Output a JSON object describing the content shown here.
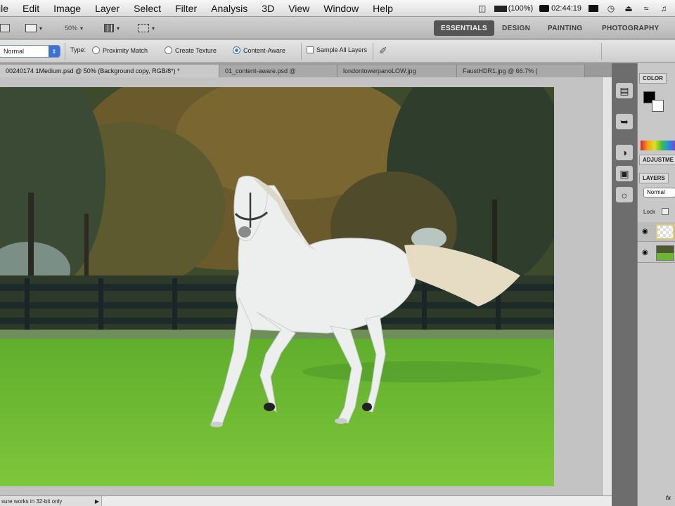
{
  "menubar": {
    "items": [
      "ile",
      "Edit",
      "Image",
      "Layer",
      "Select",
      "Filter",
      "Analysis",
      "3D",
      "View",
      "Window",
      "Help"
    ],
    "battery": "(100%)",
    "clock": "02:44:19"
  },
  "appbar": {
    "zoom": "50%",
    "workspaces": [
      "ESSENTIALS",
      "DESIGN",
      "PAINTING",
      "PHOTOGRAPHY"
    ],
    "active_workspace": "ESSENTIALS"
  },
  "options": {
    "mode": "Normal",
    "type_label": "Type:",
    "proximity": "Proximity Match",
    "create_texture": "Create Texture",
    "content_aware": "Content-Aware",
    "sample_all": "Sample All Layers",
    "selected_type": "Content-Aware"
  },
  "doc_tabs": [
    "00240174 1Medium.psd @ 50% (Background copy, RGB/8*) *",
    "01_content-aware.psd @",
    "londontowerpanoLOW.jpg",
    "FaustHDR1.jpg @ 66.7% ("
  ],
  "status": {
    "text": "sure works in 32-bit only"
  },
  "panels": {
    "color_tab": "COLOR",
    "adjustments_tab": "ADJUSTME",
    "layers_tab": "LAYERS",
    "blend_mode": "Normal",
    "lock_label": "Lock",
    "bottom_label": "fx"
  },
  "colors": {
    "accent": "#3b72d6",
    "workspace_active_bg": "#555555",
    "foreground_swatch": "#000000",
    "background_swatch": "#ffffff"
  }
}
